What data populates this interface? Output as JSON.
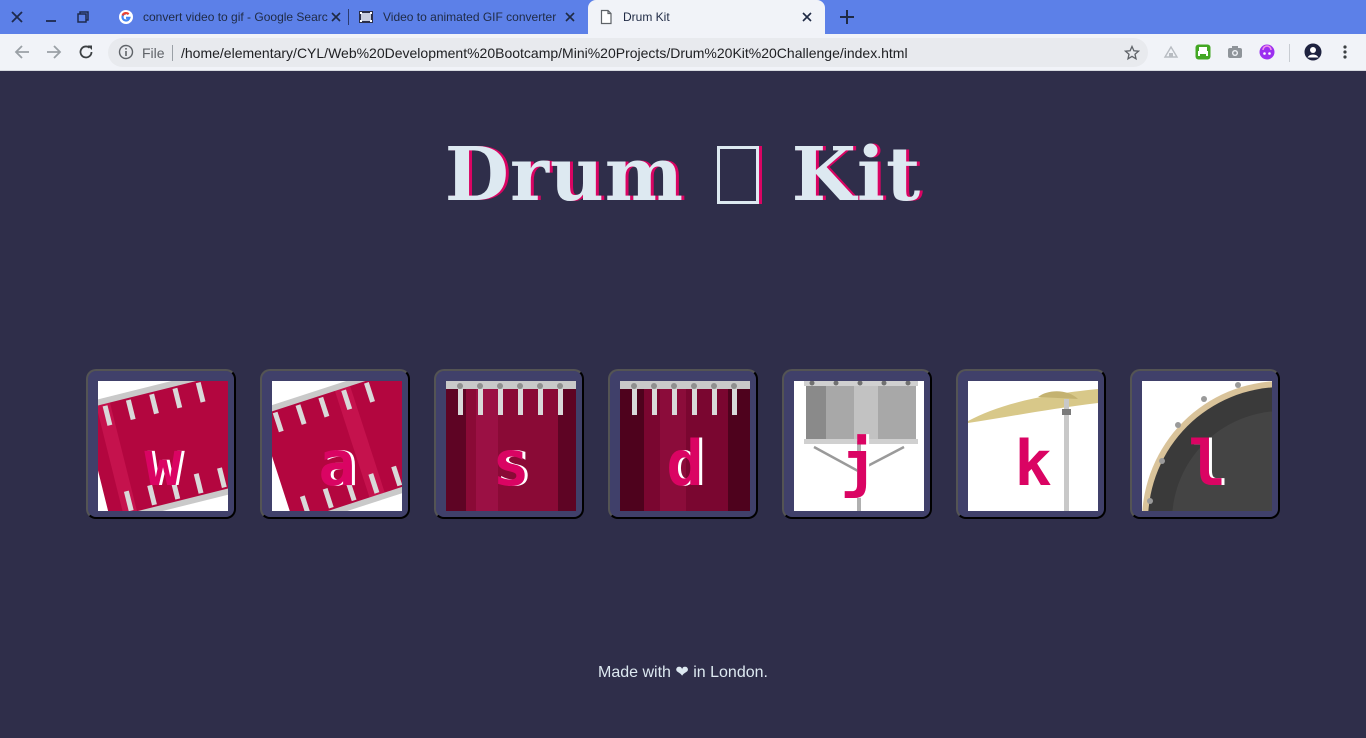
{
  "browser": {
    "tabs": [
      {
        "title": "convert video to gif - Google Search",
        "favicon": "google-icon"
      },
      {
        "title": "Video to animated GIF converter",
        "favicon": "film-icon"
      },
      {
        "title": "Drum Kit",
        "favicon": "page-icon",
        "active": true
      }
    ],
    "toolbar": {
      "scheme_label": "File",
      "url": "/home/elementary/CYL/Web%20Development%20Bootcamp/Mini%20Projects/Drum%20Kit%20Challenge/index.html"
    },
    "colors": {
      "tabstrip": "#5c80e8",
      "toolbar": "#f1f3f8"
    }
  },
  "page": {
    "title_before": "Drum ",
    "title_after": " Kit",
    "drums": [
      {
        "key": "w",
        "image": "tom-1"
      },
      {
        "key": "a",
        "image": "tom-2"
      },
      {
        "key": "s",
        "image": "tom-3"
      },
      {
        "key": "d",
        "image": "tom-4"
      },
      {
        "key": "j",
        "image": "snare"
      },
      {
        "key": "k",
        "image": "crash"
      },
      {
        "key": "l",
        "image": "kick"
      }
    ],
    "footer": "Made with ❤ in London.",
    "colors": {
      "background": "#2f2e4a",
      "accent": "#da0463",
      "title": "#dde9f1",
      "tile": "#40406a"
    }
  }
}
